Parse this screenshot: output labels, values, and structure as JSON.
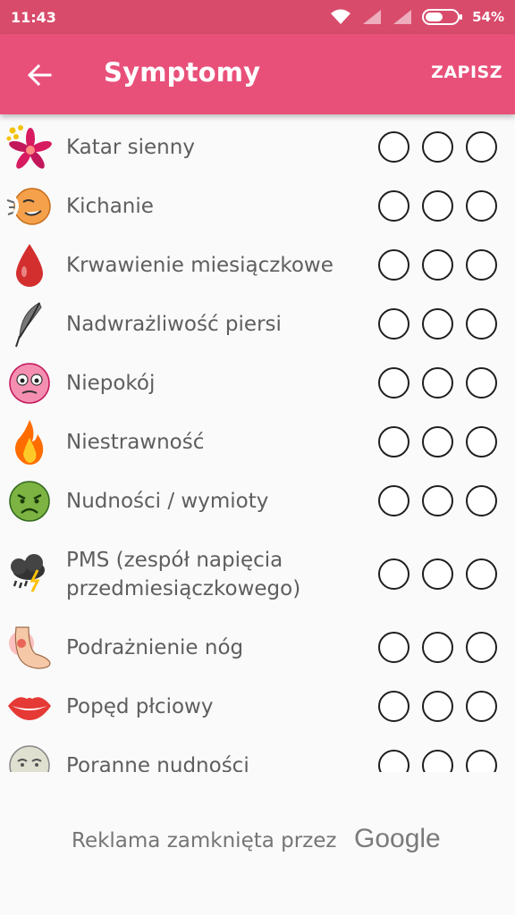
{
  "status_bar": {
    "time": "11:43",
    "battery": "54%"
  },
  "app_bar": {
    "title": "Symptomy",
    "save_label": "ZAPISZ"
  },
  "symptoms": [
    {
      "label": "Katar sienny",
      "icon": "flower-icon"
    },
    {
      "label": "Kichanie",
      "icon": "sneezing-face-icon"
    },
    {
      "label": "Krwawienie miesiączkowe",
      "icon": "blood-drop-icon"
    },
    {
      "label": "Nadwrażliwość piersi",
      "icon": "feather-icon"
    },
    {
      "label": "Niepokój",
      "icon": "anxious-face-icon"
    },
    {
      "label": "Niestrawność",
      "icon": "flame-icon"
    },
    {
      "label": "Nudności / wymioty",
      "icon": "nauseous-face-icon"
    },
    {
      "label": "PMS (zespół napięcia przedmiesiączkowego)",
      "icon": "storm-cloud-icon"
    },
    {
      "label": "Podrażnienie nóg",
      "icon": "foot-icon"
    },
    {
      "label": "Popęd płciowy",
      "icon": "lips-icon"
    },
    {
      "label": "Poranne nudności",
      "icon": "sick-face-icon"
    }
  ],
  "ad": {
    "text": "Reklama zamknięta przez",
    "brand": "Google"
  },
  "colors": {
    "status_bar": "#d84b6b",
    "app_bar": "#e8507a",
    "background": "#fafafa"
  }
}
